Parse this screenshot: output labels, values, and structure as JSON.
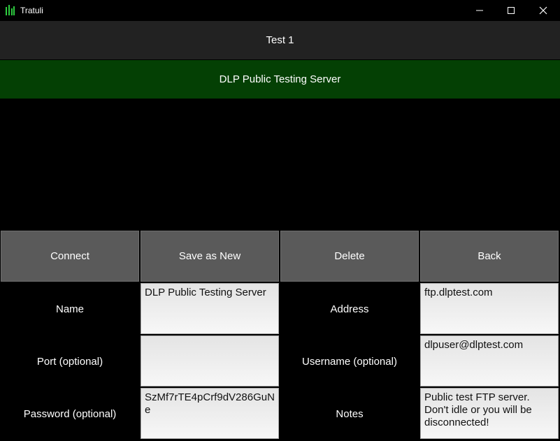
{
  "window": {
    "title": "Tratuli",
    "controls": {
      "minimize": "minimize-icon",
      "maximize": "maximize-icon",
      "close": "close-icon"
    }
  },
  "header": {
    "title": "Test 1"
  },
  "list": {
    "selected_item": "DLP Public Testing Server"
  },
  "actions": {
    "connect": "Connect",
    "save_as_new": "Save as New",
    "delete": "Delete",
    "back": "Back"
  },
  "form": {
    "name": {
      "label": "Name",
      "value": "DLP Public Testing Server"
    },
    "address": {
      "label": "Address",
      "value": "ftp.dlptest.com"
    },
    "port": {
      "label": "Port (optional)",
      "value": ""
    },
    "username": {
      "label": "Username (optional)",
      "value": "dlpuser@dlptest.com"
    },
    "password": {
      "label": "Password (optional)",
      "value": "SzMf7rTE4pCrf9dV286GuNe"
    },
    "notes": {
      "label": "Notes",
      "value": "Public test FTP server. Don't idle or you will be disconnected!"
    }
  },
  "colors": {
    "header_bg": "#222222",
    "selected_bg": "#044004",
    "button_bg": "#5a5a5a",
    "field_bg": "#f2f2f2",
    "app_icon": "#2ecc40"
  }
}
